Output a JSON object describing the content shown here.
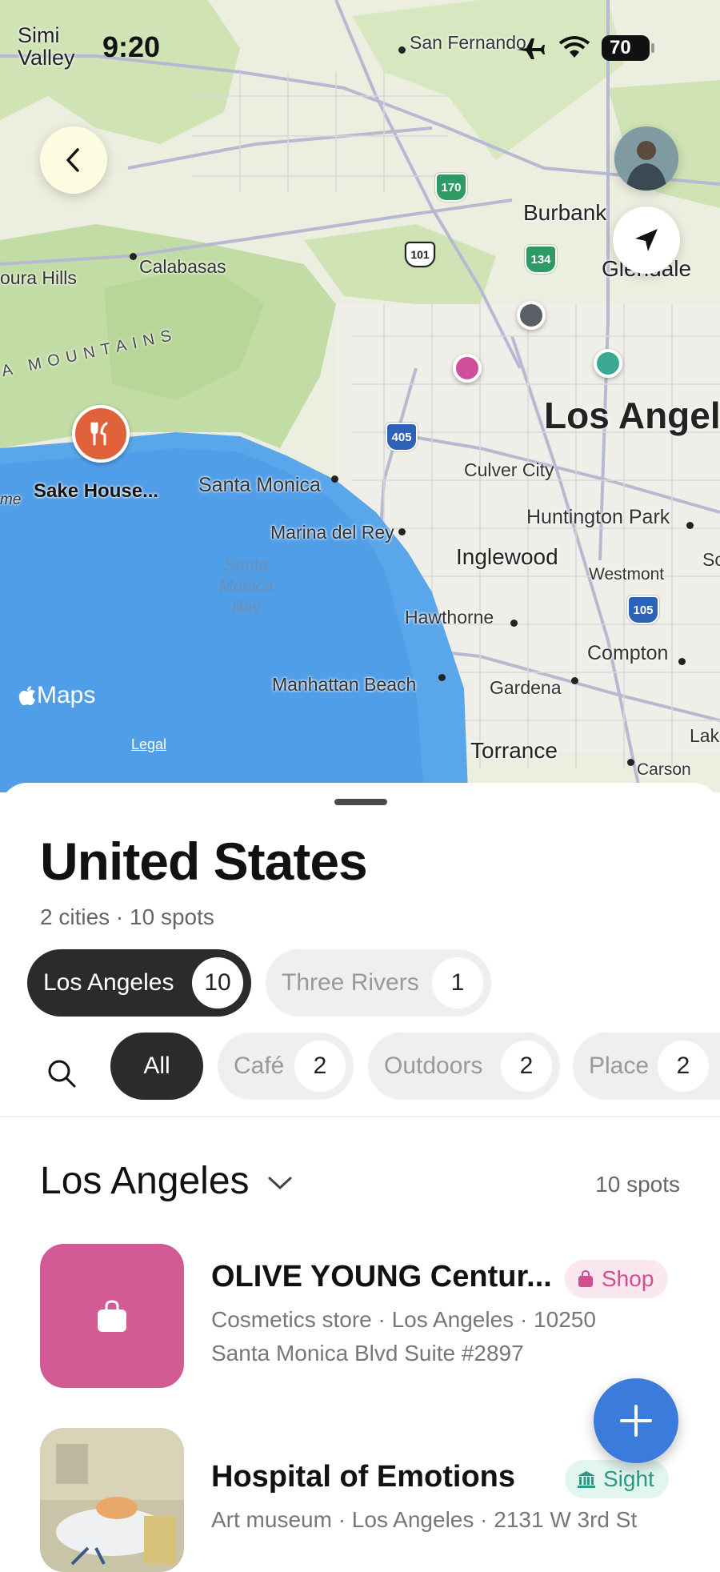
{
  "status_bar": {
    "time": "9:20",
    "battery": "70"
  },
  "map": {
    "watermark": "Maps",
    "legal": "Legal",
    "labels": {
      "simi_valley_1": "Simi",
      "simi_valley_2": "Valley",
      "san_fernando": "San Fernando",
      "burbank": "Burbank",
      "glendale": "Glendale",
      "calabasas": "Calabasas",
      "agoura_hills": "oura Hills",
      "mountains": "A MOUNTAINS",
      "los_angeles": "Los Angel",
      "culver_city": "Culver City",
      "santa_monica": "Santa Monica",
      "marina_del_rey": "Marina del Rey",
      "huntington_park": "Huntington Park",
      "inglewood": "Inglewood",
      "westmont": "Westmont",
      "hawthorne": "Hawthorne",
      "compton": "Compton",
      "manhattan_beach": "Manhattan Beach",
      "gardena": "Gardena",
      "torrance": "Torrance",
      "carson": "Carson",
      "lak": "Lak",
      "so": "So",
      "me": "me",
      "bay_1": "Santa",
      "bay_2": "Monica",
      "bay_3": "Bay",
      "sake_house": "Sake House..."
    },
    "shields": {
      "ca170": "170",
      "us101": "101",
      "ca134": "134",
      "i405": "405",
      "i105": "105"
    }
  },
  "sheet": {
    "title": "United States",
    "subtitle": "2 cities · 10 spots",
    "cities": [
      {
        "label": "Los Angeles",
        "count": "10",
        "selected": true
      },
      {
        "label": "Three Rivers",
        "count": "1",
        "selected": false
      }
    ],
    "filters": [
      {
        "label": "All",
        "selected": true
      },
      {
        "label": "Café",
        "count": "2"
      },
      {
        "label": "Outdoors",
        "count": "2"
      },
      {
        "label": "Place",
        "count": "2"
      }
    ],
    "section": {
      "title": "Los Angeles",
      "count": "10 spots"
    },
    "spots": [
      {
        "name": "OLIVE YOUNG Centur...",
        "desc_line1": "Cosmetics store · Los Angeles · 10250",
        "desc_line2": "Santa Monica Blvd Suite #2897",
        "tag": "Shop",
        "tag_color": "#cf4f8f",
        "thumb_color": "#d25b96",
        "icon": "shopping-bag-icon"
      },
      {
        "name": "Hospital of Emotions",
        "desc_line1": "Art museum · Los Angeles · 2131 W 3rd St",
        "tag": "Sight",
        "tag_color": "#2a9a82",
        "icon": "museum-icon"
      }
    ]
  },
  "colors": {
    "accent_blue": "#3a7bdc",
    "restaurant_orange": "#e0623a",
    "pin_pink": "#d14f9a",
    "pin_teal": "#3aa892",
    "pin_gray": "#5a5f66"
  }
}
